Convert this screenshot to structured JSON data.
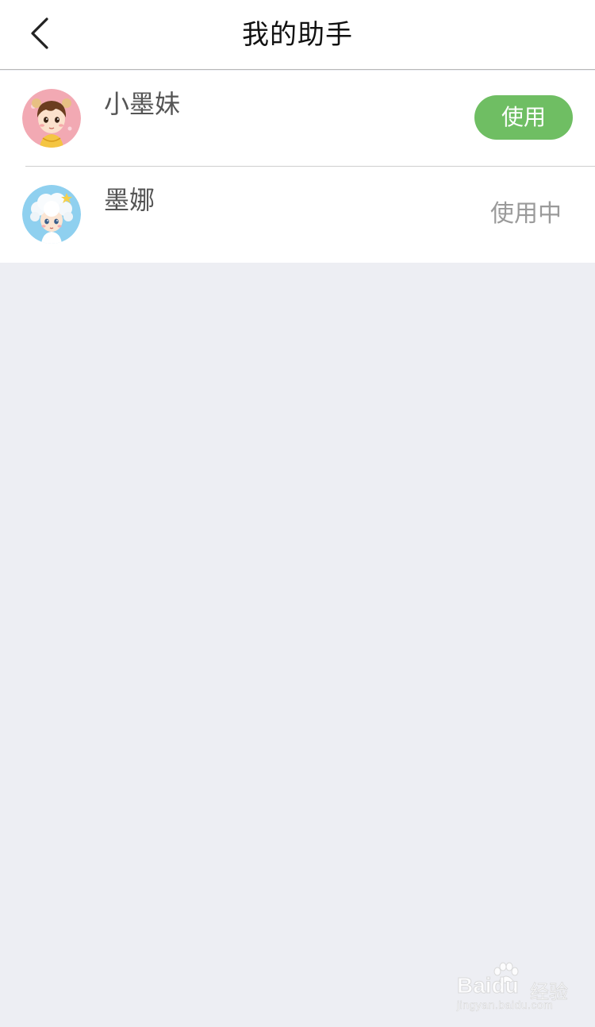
{
  "header": {
    "title": "我的助手",
    "back_icon": "chevron-left-icon"
  },
  "assistants": [
    {
      "name": "小墨妹",
      "avatar": "cartoon-girl-avatar",
      "action_label": "使用",
      "action_color": "#6fbe63"
    },
    {
      "name": "墨娜",
      "avatar": "cartoon-cloud-hair-avatar",
      "status_label": "使用中"
    }
  ],
  "watermark": {
    "brand": "Baidu",
    "suffix": "经验",
    "url": "jingyan.baidu.com"
  },
  "colors": {
    "background": "#edeef3",
    "accent": "#6fbe63",
    "status_text": "#9a9a9a"
  }
}
